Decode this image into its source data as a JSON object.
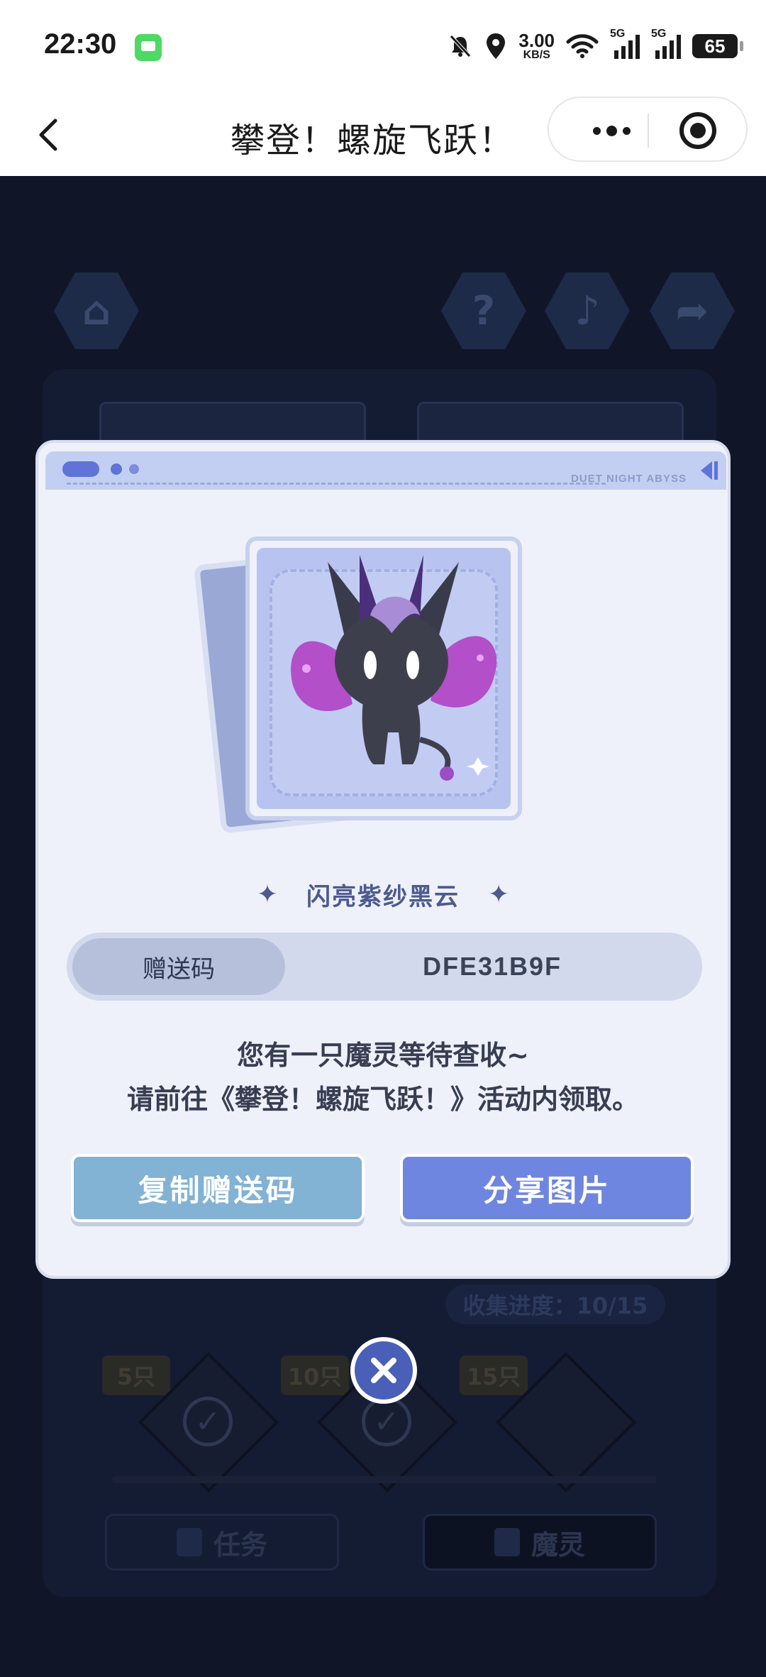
{
  "status_bar": {
    "time": "22:30",
    "net_speed_value": "3.00",
    "net_speed_unit": "KB/S",
    "sim1_label": "5G",
    "sim2_label": "5G",
    "battery": "65",
    "icons": [
      "message-icon",
      "mute-bell-icon",
      "location-icon",
      "wifi-icon",
      "signal-icon",
      "battery-icon"
    ]
  },
  "nav": {
    "title": "攀登！螺旋飞跃！",
    "icons": [
      "back-arrow-icon",
      "more-dots-icon",
      "close-miniprogram-icon"
    ]
  },
  "game_background": {
    "top_icons": [
      "home-icon",
      "help-icon",
      "music-icon",
      "share-icon"
    ],
    "progress_text": "收集进度：10/15",
    "milestones": [
      "5只",
      "10只",
      "15只"
    ],
    "tabs": [
      "任务",
      "魔灵"
    ]
  },
  "modal": {
    "brand": "DUET NIGHT ABYSS",
    "pet_name": "闪亮紫纱黑云",
    "code_label": "赠送码",
    "code_value": "DFE31B9F",
    "message_line1": "您有一只魔灵等待查收~",
    "message_line2": "请前往《攀登！螺旋飞跃！》活动内领取。",
    "copy_button": "复制赠送码",
    "share_button": "分享图片",
    "close_icon": "close-x-icon"
  },
  "colors": {
    "modal_bg": "#eef1fa",
    "header_strip": "#c3cff2",
    "copy_button": "#82b2d4",
    "share_button": "#6f86e0",
    "close_button": "#4a5fb8",
    "backdrop": "#101628"
  }
}
